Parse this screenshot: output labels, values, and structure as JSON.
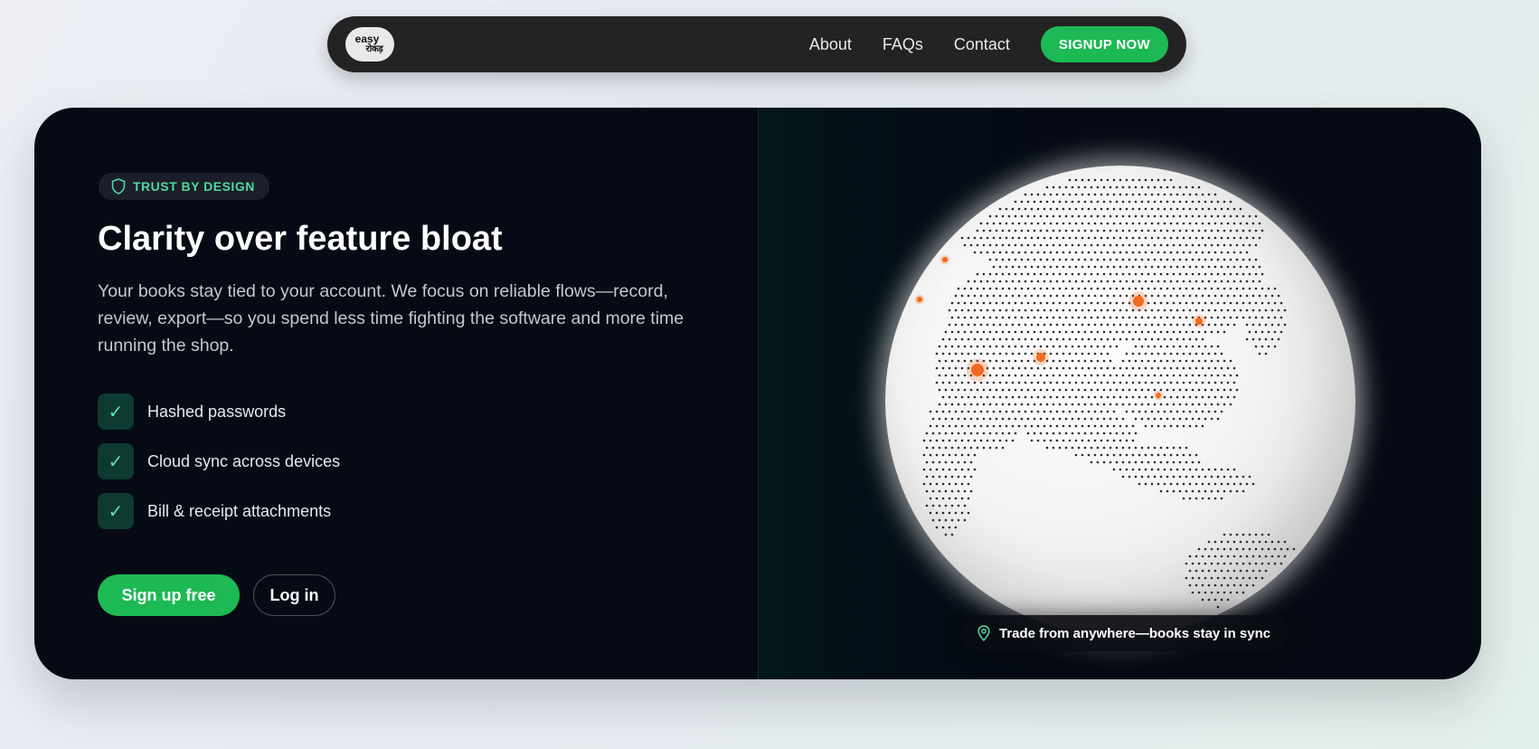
{
  "nav": {
    "logo_line1": "easy",
    "logo_line2": "रोकड़",
    "links": [
      "About",
      "FAQs",
      "Contact"
    ],
    "cta": "SIGNUP NOW"
  },
  "hero": {
    "badge_icon": "shield-icon",
    "badge": "TRUST BY DESIGN",
    "title": "Clarity over feature bloat",
    "description": "Your books stay tied to your account. We focus on reliable flows—record, review, export—so you spend less time fighting the software and more time running the shop.",
    "features": [
      {
        "icon": "check-icon",
        "label": "Hashed passwords"
      },
      {
        "icon": "check-icon",
        "label": "Cloud sync across devices"
      },
      {
        "icon": "check-icon",
        "label": "Bill & receipt attachments"
      }
    ],
    "primary_button": "Sign up free",
    "secondary_button": "Log in",
    "globe_caption_icon": "map-pin-icon",
    "globe_caption": "Trade from anywhere—books stay in sync"
  },
  "colors": {
    "accent": "#1db954",
    "badge_text": "#4fd8a0",
    "card_bg": "#050a14",
    "nav_bg": "#222322",
    "hotspot": "#f26a21"
  }
}
